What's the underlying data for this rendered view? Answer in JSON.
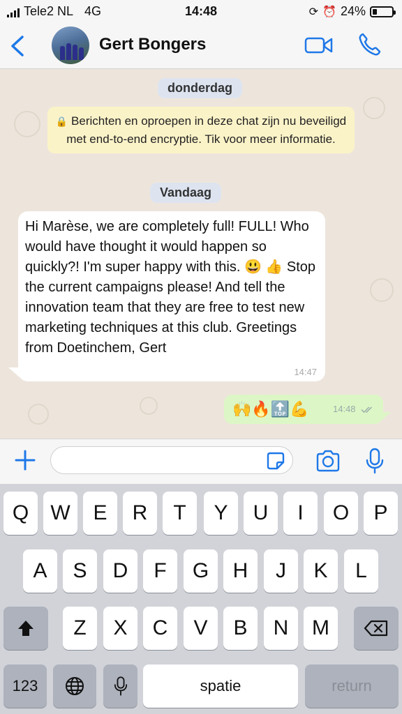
{
  "status_bar": {
    "carrier": "Tele2 NL",
    "network": "4G",
    "time": "14:48",
    "battery_pct": "24%",
    "battery_level": 0.24
  },
  "header": {
    "contact_name": "Gert Bongers"
  },
  "chat": {
    "date1": "donderdag",
    "system_message": "Berichten en oproepen in deze chat zijn nu beveiligd met end-to-end encryptie. Tik voor meer informatie.",
    "date2": "Vandaag",
    "incoming": {
      "text": "Hi Marèse, we are completely full! FULL! Who would have thought it would happen so quickly?! I'm super happy with this. 😃 👍 Stop the current campaigns please! And tell the innovation team that they are free to test new marketing techniques at this club. Greetings from Doetinchem, Gert",
      "time": "14:47"
    },
    "outgoing": {
      "emojis": "🙌🔥🔝💪",
      "time": "14:48",
      "status": "read"
    }
  },
  "input": {
    "placeholder": "",
    "value": ""
  },
  "keyboard": {
    "row1": [
      "Q",
      "W",
      "E",
      "R",
      "T",
      "Y",
      "U",
      "I",
      "O",
      "P"
    ],
    "row2": [
      "A",
      "S",
      "D",
      "F",
      "G",
      "H",
      "J",
      "K",
      "L"
    ],
    "row3": [
      "Z",
      "X",
      "C",
      "V",
      "B",
      "N",
      "M"
    ],
    "numbers_key": "123",
    "space_key": "spatie",
    "return_key": "return"
  },
  "colors": {
    "accent": "#1e78e8",
    "chat_bg": "#ede5dc",
    "outgoing_bubble": "#dcf7c5",
    "system_bubble": "#fbf3c8",
    "date_pill": "#dde4f0"
  }
}
